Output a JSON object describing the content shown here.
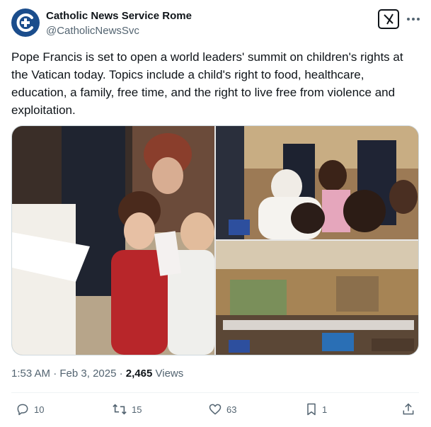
{
  "account": {
    "name": "Catholic News Service Rome",
    "handle": "@CatholicNewsSvc",
    "avatar_icon": "cns-logo-icon",
    "brand_color": "#1b4d8c"
  },
  "post": {
    "text": "Pope Francis is set to open a world leaders' summit on children's rights at the Vatican today. Topics include a child's right to food, healthcare, education, a family, free time, and the right to live free from violence and exploitation.",
    "time": "1:53 AM",
    "separator": "·",
    "date": "Feb 3, 2025",
    "views_count": "2,465",
    "views_label": "Views"
  },
  "actions": {
    "replies": "10",
    "reposts": "15",
    "likes": "63",
    "bookmarks": "1"
  },
  "colors": {
    "text": "#0f1419",
    "muted": "#536471",
    "border": "#cfd9de"
  }
}
